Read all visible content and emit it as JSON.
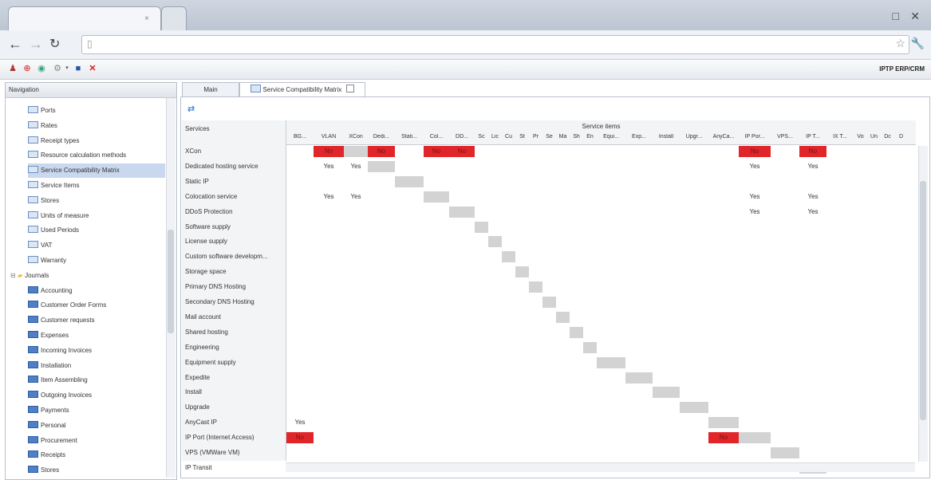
{
  "browser": {
    "tab_close": "×",
    "win_min": "□",
    "win_close": "✕"
  },
  "app": {
    "brand": "IPTP ERP/CRM",
    "toolbar_icons": [
      "user-icon",
      "lifebuoy-icon",
      "globe-icon",
      "gear-icon",
      "save-icon",
      "close-icon"
    ]
  },
  "navigation": {
    "title": "Navigation",
    "items": [
      {
        "label": "Ports",
        "type": "table",
        "indent": 1
      },
      {
        "label": "Rates",
        "type": "table",
        "indent": 1
      },
      {
        "label": "Receipt types",
        "type": "table",
        "indent": 1
      },
      {
        "label": "Resource calculation methods",
        "type": "table",
        "indent": 1
      },
      {
        "label": "Service Compatibility Matrix",
        "type": "table",
        "indent": 1,
        "selected": true
      },
      {
        "label": "Service Items",
        "type": "table",
        "indent": 1
      },
      {
        "label": "Stores",
        "type": "table",
        "indent": 1
      },
      {
        "label": "Units of measure",
        "type": "table",
        "indent": 1
      },
      {
        "label": "Used Periods",
        "type": "table",
        "indent": 1
      },
      {
        "label": "VAT",
        "type": "table",
        "indent": 1
      },
      {
        "label": "Warranty",
        "type": "table",
        "indent": 1
      },
      {
        "label": "Journals",
        "type": "folder",
        "indent": 0
      },
      {
        "label": "Accounting",
        "type": "journal",
        "indent": 1
      },
      {
        "label": "Customer Order Forms",
        "type": "journal",
        "indent": 1
      },
      {
        "label": "Customer requests",
        "type": "journal",
        "indent": 1
      },
      {
        "label": "Expenses",
        "type": "journal",
        "indent": 1
      },
      {
        "label": "Incoming Invoices",
        "type": "journal",
        "indent": 1
      },
      {
        "label": "Installation",
        "type": "journal",
        "indent": 1
      },
      {
        "label": "Item Assembling",
        "type": "journal",
        "indent": 1
      },
      {
        "label": "Outgoing Invoices",
        "type": "journal",
        "indent": 1
      },
      {
        "label": "Payments",
        "type": "journal",
        "indent": 1
      },
      {
        "label": "Personal",
        "type": "journal",
        "indent": 1
      },
      {
        "label": "Procurement",
        "type": "journal",
        "indent": 1
      },
      {
        "label": "Receipts",
        "type": "journal",
        "indent": 1
      },
      {
        "label": "Stores",
        "type": "journal",
        "indent": 1
      }
    ]
  },
  "tabs": [
    {
      "label": "Main"
    },
    {
      "label": "Service Compatibility Matrix",
      "active": true
    }
  ],
  "matrix": {
    "row_header": "Services",
    "col_group": "Service items",
    "columns": [
      "BG...",
      "VLAN",
      "XCon",
      "Dedi...",
      "Stati...",
      "Col...",
      "DD...",
      "Sc",
      "Lic",
      "Cu",
      "St",
      "Pr",
      "Se",
      "Ma",
      "Sh",
      "En",
      "Equi...",
      "Exp...",
      "Install",
      "Upgr...",
      "AnyCa...",
      "IP Por...",
      "VPS...",
      "IP T...",
      "IX T...",
      "Vo",
      "Un",
      "Dc",
      "D"
    ],
    "rows": [
      "XCon",
      "Dedicated hosting service",
      "Static IP",
      "Colocation service",
      "DDoS Protection",
      "Software supply",
      "License supply",
      "Custom software developm...",
      "Storage space",
      "Primary DNS Hosting",
      "Secondary DNS Hosting",
      "Mail account",
      "Shared hosting",
      "Engineering",
      "Equipment supply",
      "Expedite",
      "Install",
      "Upgrade",
      "AnyCast IP",
      "IP Port (Internet Access)",
      "VPS (VMWare VM)",
      "IP Transit"
    ],
    "yes_label": "Yes",
    "no_label": "No",
    "red_cells": [
      [
        0,
        1
      ],
      [
        0,
        3
      ],
      [
        0,
        5
      ],
      [
        0,
        6
      ],
      [
        0,
        21
      ],
      [
        0,
        23
      ],
      [
        19,
        0
      ],
      [
        19,
        20
      ]
    ],
    "yes_cells": [
      [
        1,
        1
      ],
      [
        1,
        2
      ],
      [
        1,
        21
      ],
      [
        1,
        23
      ],
      [
        3,
        1
      ],
      [
        3,
        2
      ],
      [
        3,
        21
      ],
      [
        3,
        23
      ],
      [
        4,
        21
      ],
      [
        4,
        23
      ],
      [
        18,
        0
      ]
    ],
    "gray_cells": [
      [
        0,
        2
      ],
      [
        1,
        3
      ],
      [
        2,
        4
      ],
      [
        3,
        5
      ],
      [
        4,
        6
      ],
      [
        5,
        7
      ],
      [
        6,
        8
      ],
      [
        7,
        9
      ],
      [
        8,
        10
      ],
      [
        9,
        11
      ],
      [
        10,
        12
      ],
      [
        11,
        13
      ],
      [
        12,
        14
      ],
      [
        13,
        15
      ],
      [
        14,
        16
      ],
      [
        15,
        17
      ],
      [
        16,
        18
      ],
      [
        17,
        19
      ],
      [
        18,
        20
      ],
      [
        19,
        21
      ],
      [
        20,
        22
      ],
      [
        21,
        23
      ]
    ]
  }
}
